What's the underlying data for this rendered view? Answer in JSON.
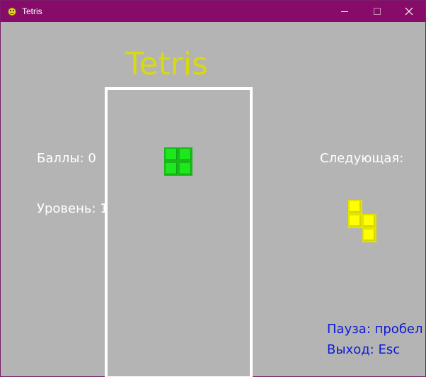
{
  "window": {
    "title": "Tetris",
    "controls": [
      "minimize-icon",
      "maximize-icon",
      "close-icon"
    ]
  },
  "game": {
    "title": "Tetris",
    "score_label": "Баллы: 0",
    "level_label": "Уровень: 1",
    "next_label": "Следующая:",
    "pause_hint": "Пауза: пробел",
    "exit_hint": "Выход: Esc",
    "current_piece": {
      "shape": "O",
      "color": "#1de81d"
    },
    "next_piece": {
      "shape": "S",
      "color": "#ffff00"
    }
  },
  "colors": {
    "background": "#b4b4b4",
    "titlebar": "#870c6a",
    "title_text": "#d9d90f",
    "hint_text": "#0d1bd4",
    "board_border": "#ffffff"
  }
}
